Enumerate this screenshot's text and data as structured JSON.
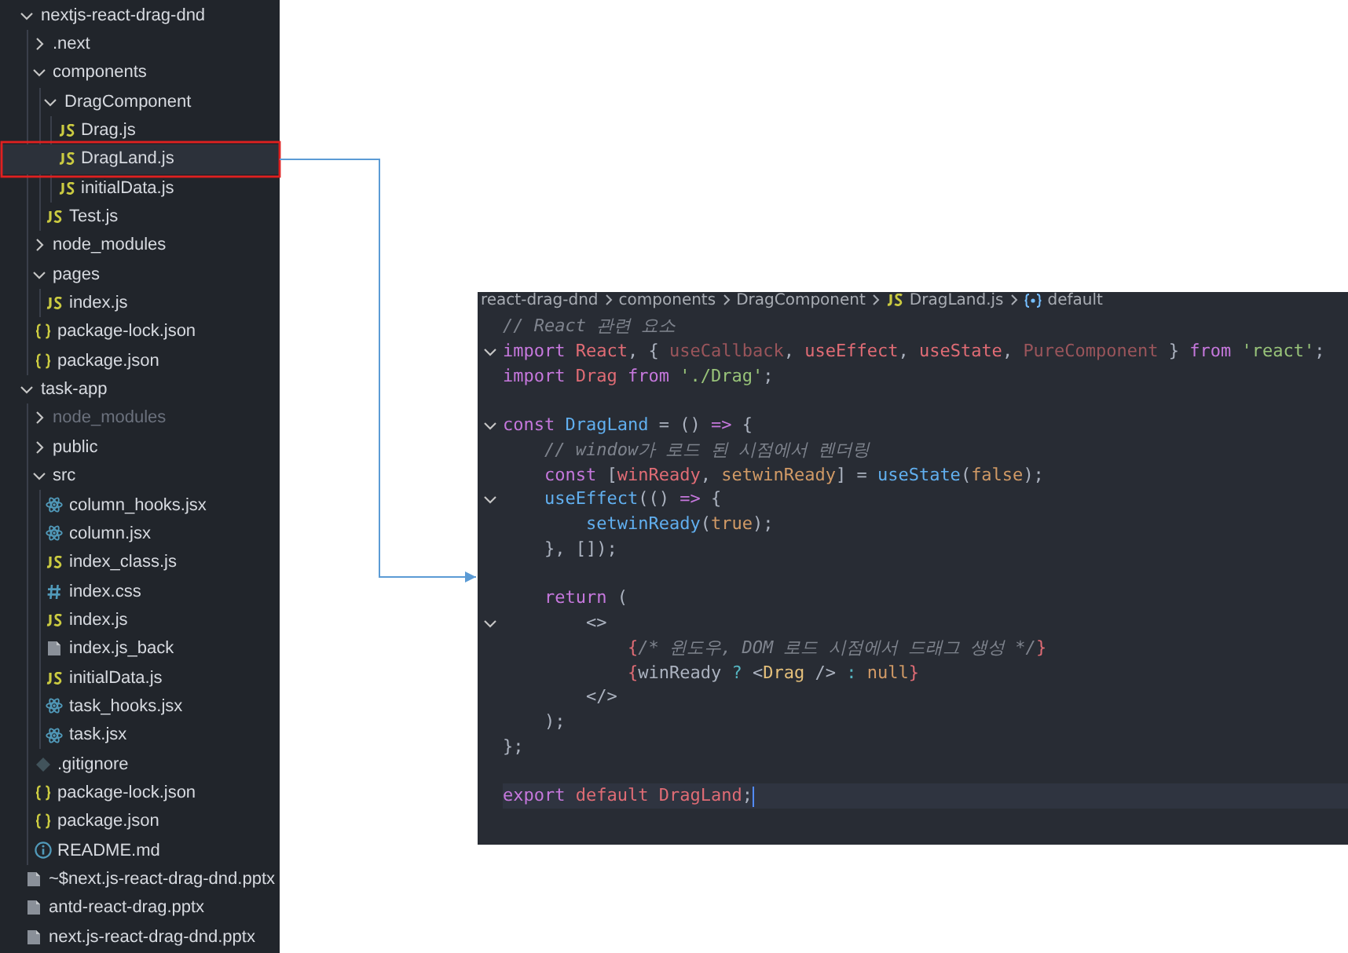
{
  "explorer": {
    "items": [
      {
        "label": "nextjs-react-drag-dnd",
        "kind": "folder",
        "expanded": true,
        "selected": false,
        "dimmed": false,
        "children": [
          {
            "label": ".next",
            "kind": "folder",
            "expanded": false,
            "selected": false,
            "dimmed": false
          },
          {
            "label": "components",
            "kind": "folder",
            "expanded": true,
            "selected": false,
            "dimmed": false,
            "children": [
              {
                "label": "DragComponent",
                "kind": "folder",
                "expanded": true,
                "selected": false,
                "dimmed": false,
                "children": [
                  {
                    "label": "Drag.js",
                    "kind": "js",
                    "selected": false,
                    "dimmed": false
                  },
                  {
                    "label": "DragLand.js",
                    "kind": "js",
                    "selected": true,
                    "dimmed": false
                  },
                  {
                    "label": "initialData.js",
                    "kind": "js",
                    "selected": false,
                    "dimmed": false
                  }
                ]
              },
              {
                "label": "Test.js",
                "kind": "js",
                "selected": false,
                "dimmed": false
              }
            ]
          },
          {
            "label": "node_modules",
            "kind": "folder",
            "expanded": false,
            "selected": false,
            "dimmed": false
          },
          {
            "label": "pages",
            "kind": "folder",
            "expanded": true,
            "selected": false,
            "dimmed": false,
            "children": [
              {
                "label": "index.js",
                "kind": "js",
                "selected": false,
                "dimmed": false
              }
            ]
          },
          {
            "label": "package-lock.json",
            "kind": "json",
            "selected": false,
            "dimmed": false
          },
          {
            "label": "package.json",
            "kind": "json",
            "selected": false,
            "dimmed": false
          }
        ]
      },
      {
        "label": "task-app",
        "kind": "folder",
        "expanded": true,
        "selected": false,
        "dimmed": false,
        "children": [
          {
            "label": "node_modules",
            "kind": "folder",
            "expanded": false,
            "selected": false,
            "dimmed": true
          },
          {
            "label": "public",
            "kind": "folder",
            "expanded": false,
            "selected": false,
            "dimmed": false
          },
          {
            "label": "src",
            "kind": "folder",
            "expanded": true,
            "selected": false,
            "dimmed": false,
            "children": [
              {
                "label": "column_hooks.jsx",
                "kind": "react",
                "selected": false,
                "dimmed": false
              },
              {
                "label": "column.jsx",
                "kind": "react",
                "selected": false,
                "dimmed": false
              },
              {
                "label": "index_class.js",
                "kind": "js",
                "selected": false,
                "dimmed": false
              },
              {
                "label": "index.css",
                "kind": "css",
                "selected": false,
                "dimmed": false
              },
              {
                "label": "index.js",
                "kind": "js",
                "selected": false,
                "dimmed": false
              },
              {
                "label": "index.js_back",
                "kind": "file",
                "selected": false,
                "dimmed": false
              },
              {
                "label": "initialData.js",
                "kind": "js",
                "selected": false,
                "dimmed": false
              },
              {
                "label": "task_hooks.jsx",
                "kind": "react",
                "selected": false,
                "dimmed": false
              },
              {
                "label": "task.jsx",
                "kind": "react",
                "selected": false,
                "dimmed": false
              }
            ]
          },
          {
            "label": ".gitignore",
            "kind": "git",
            "selected": false,
            "dimmed": false
          },
          {
            "label": "package-lock.json",
            "kind": "json",
            "selected": false,
            "dimmed": false
          },
          {
            "label": "package.json",
            "kind": "json",
            "selected": false,
            "dimmed": false
          },
          {
            "label": "README.md",
            "kind": "info",
            "selected": false,
            "dimmed": false
          }
        ]
      },
      {
        "label": "~$next.js-react-drag-dnd.pptx",
        "kind": "file",
        "selected": false,
        "dimmed": false
      },
      {
        "label": "antd-react-drag.pptx",
        "kind": "file",
        "selected": false,
        "dimmed": false
      },
      {
        "label": "next.js-react-drag-dnd.pptx",
        "kind": "file",
        "selected": false,
        "dimmed": false
      }
    ]
  },
  "editor": {
    "breadcrumb": [
      "react-drag-dnd",
      "components",
      "DragComponent",
      "DragLand.js",
      "default"
    ],
    "lines": [
      {
        "foldable": false,
        "current": false,
        "tokens": [
          {
            "text": "// React 관련 요소",
            "kind": "comment"
          }
        ]
      },
      {
        "foldable": true,
        "current": false,
        "tokens": [
          {
            "text": "import ",
            "kind": "keyword"
          },
          {
            "text": "React",
            "kind": "var"
          },
          {
            "text": ", { ",
            "kind": "punct"
          },
          {
            "text": "useCallback",
            "kind": "unused"
          },
          {
            "text": ", ",
            "kind": "punct"
          },
          {
            "text": "useEffect",
            "kind": "var"
          },
          {
            "text": ", ",
            "kind": "punct"
          },
          {
            "text": "useState",
            "kind": "var"
          },
          {
            "text": ", ",
            "kind": "punct"
          },
          {
            "text": "PureComponent",
            "kind": "unused"
          },
          {
            "text": " } ",
            "kind": "punct"
          },
          {
            "text": "from ",
            "kind": "keyword"
          },
          {
            "text": "'react'",
            "kind": "string"
          },
          {
            "text": ";",
            "kind": "punct"
          }
        ]
      },
      {
        "foldable": false,
        "current": false,
        "tokens": [
          {
            "text": "import ",
            "kind": "keyword"
          },
          {
            "text": "Drag ",
            "kind": "var"
          },
          {
            "text": "from ",
            "kind": "keyword"
          },
          {
            "text": "'./Drag'",
            "kind": "string"
          },
          {
            "text": ";",
            "kind": "punct"
          }
        ]
      },
      {
        "foldable": false,
        "current": false
      },
      {
        "foldable": true,
        "current": false,
        "tokens": [
          {
            "text": "const ",
            "kind": "keyword"
          },
          {
            "text": "DragLand",
            "kind": "func"
          },
          {
            "text": " = () ",
            "kind": "punct"
          },
          {
            "text": "=>",
            "kind": "keyword"
          },
          {
            "text": " {",
            "kind": "punct"
          }
        ]
      },
      {
        "foldable": false,
        "current": false,
        "tokens": [
          {
            "text": "    // window가 로드 된 시점에서 렌더링",
            "kind": "comment"
          }
        ]
      },
      {
        "foldable": false,
        "current": false,
        "tokens": [
          {
            "text": "    const ",
            "kind": "keyword"
          },
          {
            "text": "[",
            "kind": "punct"
          },
          {
            "text": "winReady",
            "kind": "var"
          },
          {
            "text": ", ",
            "kind": "punct"
          },
          {
            "text": "setwinReady",
            "kind": "number"
          },
          {
            "text": "] = ",
            "kind": "punct"
          },
          {
            "text": "useState",
            "kind": "func"
          },
          {
            "text": "(",
            "kind": "punct"
          },
          {
            "text": "false",
            "kind": "number"
          },
          {
            "text": ");",
            "kind": "punct"
          }
        ]
      },
      {
        "foldable": true,
        "current": false,
        "tokens": [
          {
            "text": "    useEffect",
            "kind": "func"
          },
          {
            "text": "(() ",
            "kind": "punct"
          },
          {
            "text": "=>",
            "kind": "keyword"
          },
          {
            "text": " {",
            "kind": "punct"
          }
        ]
      },
      {
        "foldable": false,
        "current": false,
        "tokens": [
          {
            "text": "        setwinReady",
            "kind": "func"
          },
          {
            "text": "(",
            "kind": "punct"
          },
          {
            "text": "true",
            "kind": "number"
          },
          {
            "text": ");",
            "kind": "punct"
          }
        ]
      },
      {
        "foldable": false,
        "current": false,
        "tokens": [
          {
            "text": "    }, []);",
            "kind": "punct"
          }
        ]
      },
      {
        "foldable": false,
        "current": false
      },
      {
        "foldable": false,
        "current": false,
        "tokens": [
          {
            "text": "    return ",
            "kind": "keyword"
          },
          {
            "text": "(",
            "kind": "punct"
          }
        ]
      },
      {
        "foldable": true,
        "current": false,
        "tokens": [
          {
            "text": "        <>",
            "kind": "punct"
          }
        ]
      },
      {
        "foldable": false,
        "current": false,
        "tokens": [
          {
            "text": "            {",
            "kind": "var"
          },
          {
            "text": "/* 윈도우, DOM 로드 시점에서 드래그 생성 */",
            "kind": "comment"
          },
          {
            "text": "}",
            "kind": "var"
          }
        ]
      },
      {
        "foldable": false,
        "current": false,
        "tokens": [
          {
            "text": "            {",
            "kind": "var"
          },
          {
            "text": "winReady ",
            "kind": "punct"
          },
          {
            "text": "?",
            "kind": "operator"
          },
          {
            "text": " <",
            "kind": "punct"
          },
          {
            "text": "Drag",
            "kind": "type"
          },
          {
            "text": " /> ",
            "kind": "punct"
          },
          {
            "text": ":",
            "kind": "operator"
          },
          {
            "text": " null",
            "kind": "number"
          },
          {
            "text": "}",
            "kind": "var"
          }
        ]
      },
      {
        "foldable": false,
        "current": false,
        "tokens": [
          {
            "text": "        </>",
            "kind": "punct"
          }
        ]
      },
      {
        "foldable": false,
        "current": false,
        "tokens": [
          {
            "text": "    );",
            "kind": "punct"
          }
        ]
      },
      {
        "foldable": false,
        "current": false,
        "tokens": [
          {
            "text": "};",
            "kind": "punct"
          }
        ]
      },
      {
        "foldable": false,
        "current": false
      },
      {
        "foldable": false,
        "current": true,
        "tokens": [
          {
            "text": "export ",
            "kind": "keyword"
          },
          {
            "text": "default ",
            "kind": "var"
          },
          {
            "text": "DragLand",
            "kind": "var"
          },
          {
            "text": ";",
            "kind": "punct"
          }
        ]
      }
    ]
  }
}
